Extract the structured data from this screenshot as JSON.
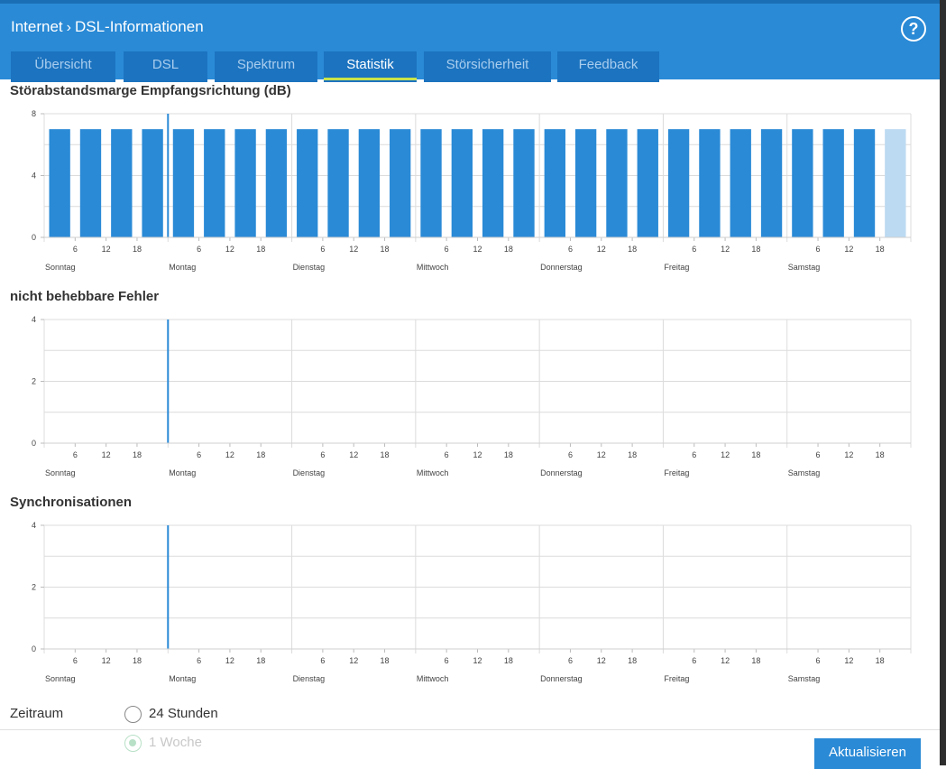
{
  "header": {
    "breadcrumb": [
      "Internet",
      "DSL-Informationen"
    ],
    "help_symbol": "?"
  },
  "tabs": [
    "Übersicht",
    "DSL",
    "Spektrum",
    "Statistik",
    "Störsicherheit",
    "Feedback"
  ],
  "active_tab": "Statistik",
  "charts": {
    "snr": {
      "title": "Störabstandsmarge Empfangsrichtung (dB)"
    },
    "errors": {
      "title": "nicht behebbare Fehler"
    },
    "sync": {
      "title": "Synchronisationen"
    }
  },
  "chart_data": [
    {
      "type": "bar",
      "title": "Störabstandsmarge Empfangsrichtung (dB)",
      "ylim": [
        0,
        8
      ],
      "yticks": [
        0,
        4,
        8
      ],
      "x_ticks": [
        "6",
        "12",
        "18"
      ],
      "day_labels": [
        "Sonntag",
        "Montag",
        "Dienstag",
        "Mittwoch",
        "Donnerstag",
        "Freitag",
        "Samstag"
      ],
      "values": [
        7,
        7,
        7,
        7,
        7,
        7,
        7,
        7,
        7,
        7,
        7,
        7,
        7,
        7,
        7,
        7,
        7,
        7,
        7,
        7,
        7,
        7,
        7,
        7,
        7,
        7,
        7,
        7
      ],
      "current_index": 27,
      "colors": {
        "bar": "#2a8ad6",
        "current": "#bcdaf2",
        "marker": "#2a8ad6",
        "grid": "#dcdcdc"
      }
    },
    {
      "type": "bar",
      "title": "nicht behebbare Fehler",
      "ylim": [
        0,
        4
      ],
      "yticks": [
        0,
        2,
        4
      ],
      "x_ticks": [
        "6",
        "12",
        "18"
      ],
      "day_labels": [
        "Sonntag",
        "Montag",
        "Dienstag",
        "Mittwoch",
        "Donnerstag",
        "Freitag",
        "Samstag"
      ],
      "values": []
    },
    {
      "type": "bar",
      "title": "Synchronisationen",
      "ylim": [
        0,
        4
      ],
      "yticks": [
        0,
        2,
        4
      ],
      "x_ticks": [
        "6",
        "12",
        "18"
      ],
      "day_labels": [
        "Sonntag",
        "Montag",
        "Dienstag",
        "Mittwoch",
        "Donnerstag",
        "Freitag",
        "Samstag"
      ],
      "values": []
    }
  ],
  "zeitraum": {
    "label": "Zeitraum",
    "options": [
      {
        "label": "24 Stunden",
        "checked": false
      },
      {
        "label": "1 Woche",
        "checked": true
      }
    ]
  },
  "buttons": {
    "refresh": "Aktualisieren"
  },
  "colors": {
    "accent": "#2a8ad6",
    "tab_bg": "#1c73bf",
    "tab_active_underline": "#c7e34a"
  }
}
